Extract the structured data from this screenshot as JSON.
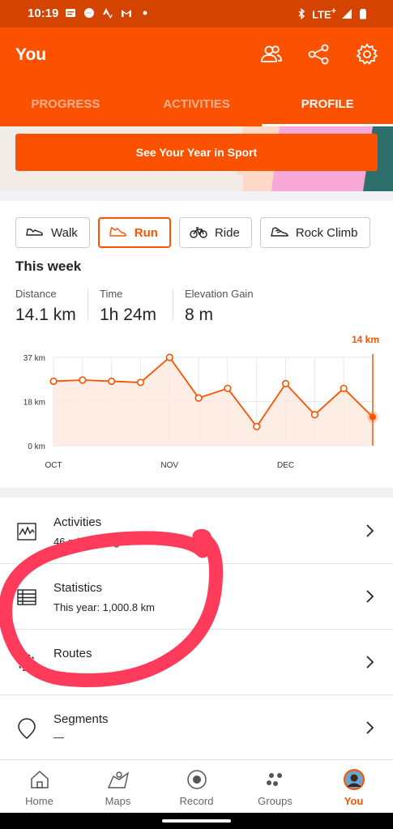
{
  "status_bar": {
    "time": "10:19",
    "network": "LTE",
    "network_plus": "+"
  },
  "header": {
    "title": "You",
    "tabs": [
      {
        "label": "PROGRESS",
        "active": false
      },
      {
        "label": "ACTIVITIES",
        "active": false
      },
      {
        "label": "PROFILE",
        "active": true
      }
    ],
    "icons": [
      "people-icon",
      "share-icon",
      "settings-gear-icon"
    ]
  },
  "banner": {
    "button_label": "See Your Year in Sport"
  },
  "sports": [
    {
      "label": "Walk",
      "icon": "shoe-icon",
      "selected": false
    },
    {
      "label": "Run",
      "icon": "running-shoe-icon",
      "selected": true
    },
    {
      "label": "Ride",
      "icon": "bike-icon",
      "selected": false
    },
    {
      "label": "Rock Climb",
      "icon": "climbing-shoe-icon",
      "selected": false
    }
  ],
  "week": {
    "title": "This week",
    "stats": [
      {
        "label": "Distance",
        "value": "14.1 km"
      },
      {
        "label": "Time",
        "value": "1h 24m"
      },
      {
        "label": "Elevation Gain",
        "value": "8 m"
      }
    ]
  },
  "chart_data": {
    "type": "line",
    "current_label": "14 km",
    "y_ticks": [
      "37 km",
      "18 km",
      "0 km"
    ],
    "x_labels": [
      "OCT",
      "NOV",
      "DEC"
    ],
    "ylim": [
      0,
      37
    ],
    "values": [
      27,
      27.5,
      27,
      26.5,
      37,
      20,
      24,
      8,
      26,
      13,
      24,
      12
    ],
    "colors": {
      "line": "#fc5200",
      "fill": "#fde9df",
      "grid": "#e6e6ee"
    }
  },
  "list": [
    {
      "title": "Activities",
      "subtitle": "46 minutes ago",
      "icon": "activity-chart-icon"
    },
    {
      "title": "Statistics",
      "subtitle": "This year: 1,000.8 km",
      "icon": "table-icon"
    },
    {
      "title": "Routes",
      "subtitle": "—",
      "icon": "route-icon"
    },
    {
      "title": "Segments",
      "subtitle": "—",
      "icon": "map-pin-icon"
    }
  ],
  "bottom_nav": [
    {
      "label": "Home",
      "icon": "home-icon",
      "active": false
    },
    {
      "label": "Maps",
      "icon": "map-icon",
      "active": false
    },
    {
      "label": "Record",
      "icon": "record-icon",
      "active": false
    },
    {
      "label": "Groups",
      "icon": "groups-icon",
      "active": false
    },
    {
      "label": "You",
      "icon": "avatar-icon",
      "active": true
    }
  ],
  "colors": {
    "brand": "#fc5200",
    "status_bar": "#d44400",
    "annotation": "#ff3b5c"
  }
}
